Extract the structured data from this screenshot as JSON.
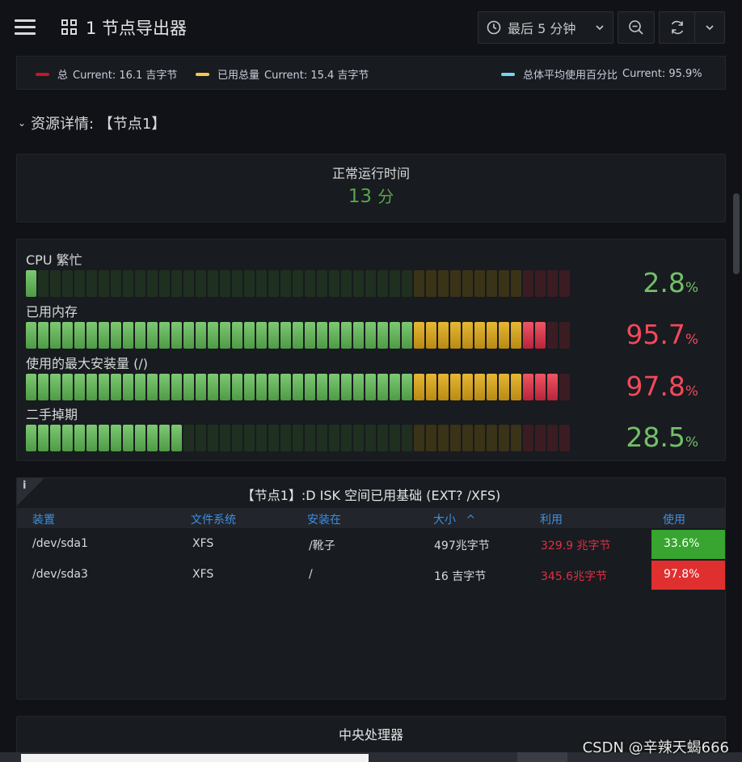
{
  "header": {
    "title": "1 节点导出器",
    "time_range": "最后 5 分钟"
  },
  "legend": {
    "items": [
      {
        "name": "总",
        "value": "Current: 16.1 吉字节",
        "color": "#c4162a"
      },
      {
        "name": "已用总量",
        "value": "Current: 15.4 吉字节",
        "color": "#f2c94c"
      },
      {
        "name": "总体平均使用百分比",
        "value": "Current: 95.9%",
        "color": "#73d5f0"
      }
    ]
  },
  "row": {
    "title": "资源详情: 【节点1】"
  },
  "uptime": {
    "title": "正常运行时间",
    "value": "13",
    "unit": "分"
  },
  "gauges": [
    {
      "label": "CPU 繁忙",
      "value": "2.8",
      "unit": "%",
      "level": 0.028,
      "color": "#73bf69"
    },
    {
      "label": "已用内存",
      "value": "95.7",
      "unit": "%",
      "level": 0.957,
      "color": "#f2495c"
    },
    {
      "label": "使用的最大安装量 (/)",
      "value": "97.8",
      "unit": "%",
      "level": 0.978,
      "color": "#f2495c"
    },
    {
      "label": "二手掉期",
      "value": "28.5",
      "unit": "%",
      "level": 0.285,
      "color": "#73bf69"
    }
  ],
  "disk_table": {
    "info_icon": "i",
    "title": "【节点1】:D ISK 空间已用基础 (EXT? /XFS)",
    "columns": [
      "装置",
      "文件系统",
      "安装在",
      "大小",
      "利用",
      "使用"
    ],
    "sort_indicator": "^",
    "rows": [
      {
        "device": "/dev/sda1",
        "fs": "XFS",
        "mount": "/靴子",
        "size": "497兆字节",
        "used": "329.9 兆字节",
        "usage": "33.6%",
        "usage_color": "#37a52f"
      },
      {
        "device": "/dev/sda3",
        "fs": "XFS",
        "mount": "/",
        "size": "16 吉字节",
        "used": "345.6兆字节",
        "usage": "97.8%",
        "usage_color": "#e02f2f"
      }
    ]
  },
  "cpu_panel": {
    "title": "中央处理器"
  },
  "watermark": "CSDN @辛辣天蝎666"
}
